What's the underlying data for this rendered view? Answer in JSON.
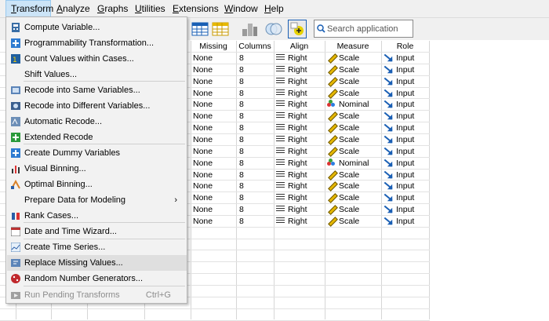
{
  "menubar": {
    "items": [
      "Transform",
      "Analyze",
      "Graphs",
      "Utilities",
      "Extensions",
      "Window",
      "Help"
    ]
  },
  "search": {
    "placeholder": "Search application"
  },
  "grid": {
    "headers": [
      "Missing",
      "Columns",
      "Align",
      "Measure",
      "Role"
    ],
    "rows": [
      {
        "missing": "None",
        "columns": "8",
        "align": "Right",
        "measure": "Scale",
        "role": "Input"
      },
      {
        "missing": "None",
        "columns": "8",
        "align": "Right",
        "measure": "Scale",
        "role": "Input"
      },
      {
        "missing": "None",
        "columns": "8",
        "align": "Right",
        "measure": "Scale",
        "role": "Input"
      },
      {
        "missing": "None",
        "columns": "8",
        "align": "Right",
        "measure": "Scale",
        "role": "Input"
      },
      {
        "missing": "None",
        "columns": "8",
        "align": "Right",
        "measure": "Nominal",
        "role": "Input"
      },
      {
        "missing": "None",
        "columns": "8",
        "align": "Right",
        "measure": "Scale",
        "role": "Input"
      },
      {
        "missing": "None",
        "columns": "8",
        "align": "Right",
        "measure": "Scale",
        "role": "Input"
      },
      {
        "missing": "None",
        "columns": "8",
        "align": "Right",
        "measure": "Scale",
        "role": "Input"
      },
      {
        "missing": "None",
        "columns": "8",
        "align": "Right",
        "measure": "Scale",
        "role": "Input"
      },
      {
        "missing": "None",
        "columns": "8",
        "align": "Right",
        "measure": "Nominal",
        "role": "Input"
      },
      {
        "missing": "None",
        "columns": "8",
        "align": "Right",
        "measure": "Scale",
        "role": "Input"
      },
      {
        "missing": "None",
        "columns": "8",
        "align": "Right",
        "measure": "Scale",
        "role": "Input"
      },
      {
        "missing": "None",
        "columns": "8",
        "align": "Right",
        "measure": "Scale",
        "role": "Input"
      },
      {
        "missing": "None",
        "columns": "8",
        "align": "Right",
        "measure": "Scale",
        "role": "Input"
      },
      {
        "missing": "None",
        "columns": "8",
        "align": "Right",
        "measure": "Scale",
        "role": "Input"
      }
    ]
  },
  "transform_menu": {
    "items": [
      {
        "label": "Compute Variable...",
        "icon": "calculator-icon"
      },
      {
        "label": "Programmability Transformation...",
        "icon": "plus-icon"
      },
      {
        "label": "Count Values within Cases...",
        "icon": "count-icon"
      },
      {
        "label": "Shift Values...",
        "icon": ""
      },
      {
        "label": "Recode into Same Variables...",
        "icon": "recode-same-icon"
      },
      {
        "label": "Recode into Different Variables...",
        "icon": "recode-different-icon"
      },
      {
        "label": "Automatic Recode...",
        "icon": "auto-recode-icon"
      },
      {
        "label": "Extended Recode",
        "icon": "extended-recode-icon"
      },
      {
        "label": "Create Dummy Variables",
        "icon": "plus-icon"
      },
      {
        "label": "Visual Binning...",
        "icon": "visual-binning-icon"
      },
      {
        "label": "Optimal Binning...",
        "icon": "optimal-binning-icon"
      },
      {
        "label": "Prepare Data for Modeling",
        "icon": "",
        "submenu": "›"
      },
      {
        "label": "Rank Cases...",
        "icon": "rank-icon"
      },
      {
        "label": "Date and Time Wizard...",
        "icon": "calendar-icon"
      },
      {
        "label": "Create Time Series...",
        "icon": "time-series-icon"
      },
      {
        "label": "Replace Missing Values...",
        "icon": "replace-missing-icon"
      },
      {
        "label": "Random Number Generators...",
        "icon": "dice-icon"
      },
      {
        "label": "Run Pending Transforms",
        "icon": "run-icon",
        "shortcut": "Ctrl+G",
        "disabled": true
      }
    ]
  },
  "colors": {
    "menubar_bg": "#f0f0f0",
    "menu_bg": "#f2f2f2",
    "hover_bg": "#dfdfdf",
    "active_menu_bg": "#cce4f7",
    "icon_blue": "#1a5fb4"
  }
}
